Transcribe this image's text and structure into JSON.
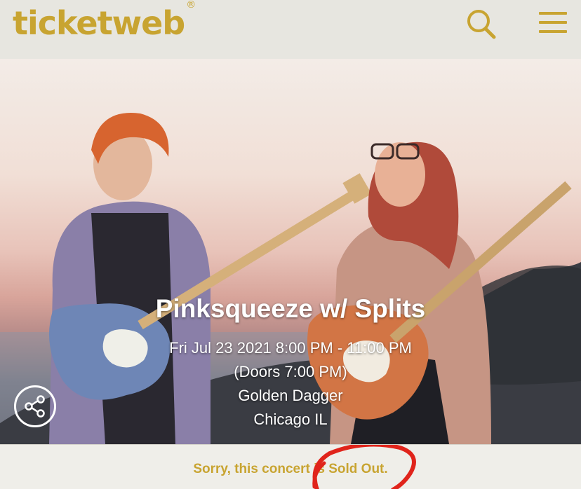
{
  "header": {
    "logo_text": "ticketweb",
    "logo_mark": "®",
    "search_icon": "search-icon",
    "menu_icon": "hamburger-menu-icon"
  },
  "event": {
    "title": "Pinksqueeze w/ Splits",
    "date_time": "Fri Jul 23 2021 8:00 PM - 11:00 PM",
    "doors": "(Doors 7:00 PM)",
    "venue": "Golden Dagger",
    "city": "Chicago IL"
  },
  "share": {
    "icon": "share-icon"
  },
  "status": {
    "message": "Sorry, this concert is Sold Out."
  },
  "colors": {
    "brand": "#c8a431",
    "annotation": "#e0241b"
  }
}
